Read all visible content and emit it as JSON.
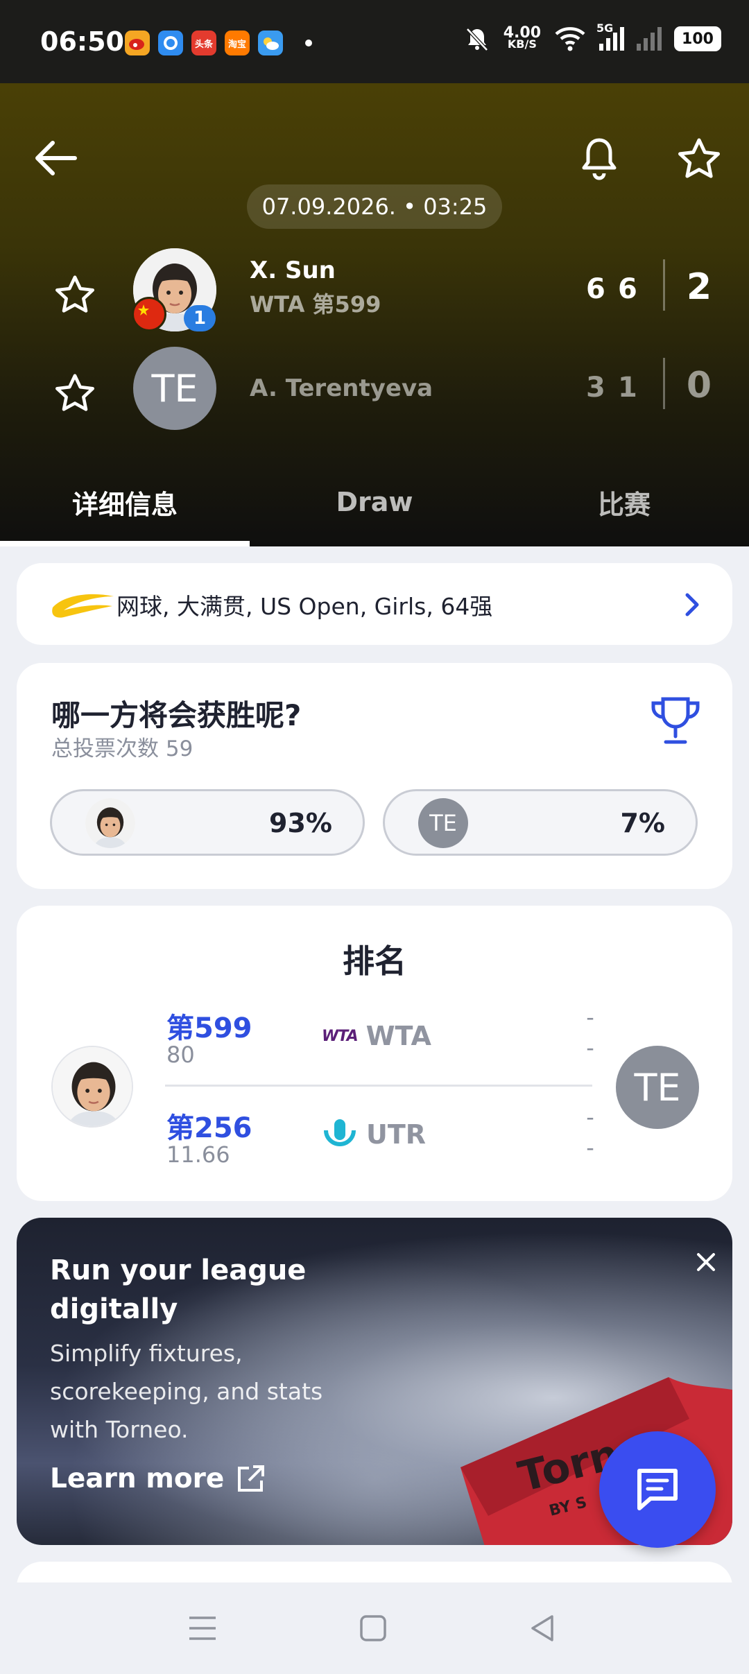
{
  "status_bar": {
    "time": "06:50",
    "net_speed_value": "4.00",
    "net_speed_unit": "KB/S",
    "network": "5G",
    "battery": "100",
    "notification_apps": [
      {
        "icon": "weibo-icon",
        "color": "#f5a623",
        "label": ""
      },
      {
        "icon": "browser-icon",
        "color": "#2f8cf0",
        "label": ""
      },
      {
        "icon": "toutiao-icon",
        "color": "#e33b2e",
        "label": "头条"
      },
      {
        "icon": "taobao-icon",
        "color": "#ff7a00",
        "label": "淘宝"
      },
      {
        "icon": "weather-icon",
        "color": "#3a9bf0",
        "label": ""
      }
    ]
  },
  "header": {
    "date_time": "07.09.2026. • 03:25",
    "player1": {
      "name": "X. Sun",
      "ranking": "WTA 第599",
      "seed": "1",
      "sets": [
        "6",
        "6"
      ],
      "sets_won": "2"
    },
    "player2": {
      "name": "A. Terentyeva",
      "initials": "TE",
      "sets": [
        "3",
        "1"
      ],
      "sets_won": "0"
    },
    "tabs": [
      {
        "label": "详细信息",
        "active": true
      },
      {
        "label": "Draw",
        "active": false
      },
      {
        "label": "比赛",
        "active": false
      }
    ]
  },
  "tournament": {
    "label": "网球, 大满贯, US Open, Girls, 64强"
  },
  "vote": {
    "title": "哪一方将会获胜呢?",
    "total": "总投票次数 59",
    "player1_pct": "93%",
    "player2_initials": "TE",
    "player2_pct": "7%"
  },
  "ranking": {
    "title": "排名",
    "player2_initials": "TE",
    "rows": [
      {
        "system": "WTA",
        "player1_rank": "第599",
        "player1_points": "80",
        "player2_rank": "-",
        "player2_points": "-"
      },
      {
        "system": "UTR",
        "player1_rank": "第256",
        "player1_points": "11.66",
        "player2_rank": "-",
        "player2_points": "-"
      }
    ],
    "wta_logo_text": "WTA"
  },
  "ad": {
    "title": "Run your league digitally",
    "description": "Simplify fixtures, scorekeeping, and stats with Torneo.",
    "link": "Learn more",
    "flag_text": "Torn",
    "flag_subtext": "BY S"
  },
  "colors": {
    "accent": "#2f4fe0",
    "fab": "#3a4df0",
    "header_top": "#4a4006",
    "header_bottom": "#0f0f0e"
  }
}
